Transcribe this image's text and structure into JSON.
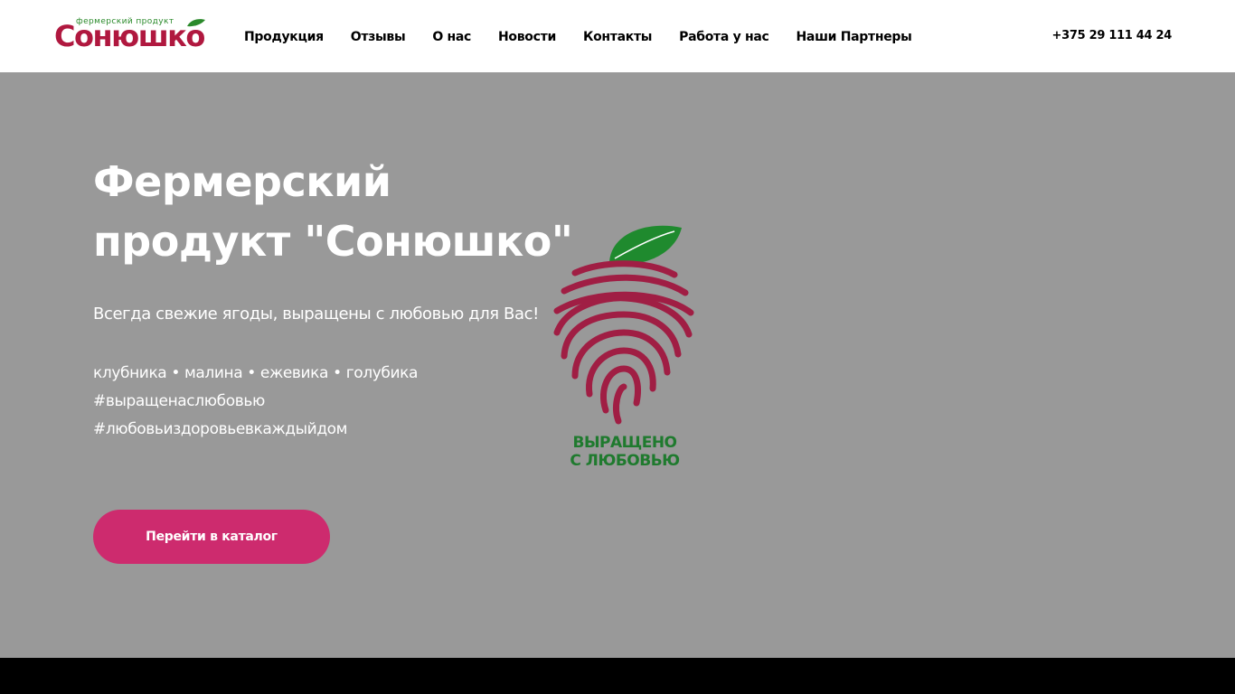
{
  "header": {
    "logo": {
      "tagline": "фермерский продукт",
      "name": "Сонюшко"
    },
    "nav": [
      {
        "label": "Продукция"
      },
      {
        "label": "Отзывы"
      },
      {
        "label": "О нас"
      },
      {
        "label": "Новости"
      },
      {
        "label": "Контакты"
      },
      {
        "label": "Работа у нас"
      },
      {
        "label": "Наши Партнеры"
      }
    ],
    "phone": "+375 29 111 44 24"
  },
  "hero": {
    "title": "Фермерский продукт \"Сонюшко\"",
    "subtitle": "Всегда свежие ягоды, выращены с любовью для Вас!",
    "tags": [
      "клубника  •  малина  •  ежевика  •  голубика",
      "#выращенаслюбовью",
      "#любовьиздоровьевкаждыйдом"
    ],
    "cta_label": "Перейти в каталог",
    "badge": {
      "line1": "ВЫРАЩЕНО",
      "line2": "С ЛЮБОВЬЮ"
    }
  },
  "colors": {
    "brand_red": "#b0183f",
    "brand_green": "#2b8a2b",
    "cta_pink": "#cd2b6e",
    "hero_bg": "#999999",
    "badge_berry": "#a01e44",
    "badge_leaf": "#1f8a2e"
  },
  "icons": {
    "logo_leaf": "leaf-icon",
    "badge": "berry-fingerprint-icon"
  }
}
